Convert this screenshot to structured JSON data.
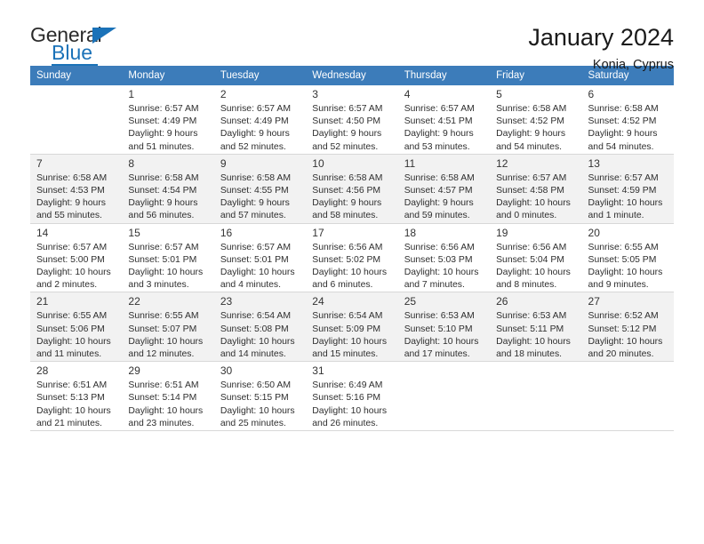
{
  "brand": {
    "name_part1": "General",
    "name_part2": "Blue",
    "accent_color": "#1b72b8"
  },
  "header": {
    "title": "January 2024",
    "subtitle": "Konia, Cyprus"
  },
  "calendar": {
    "header_bg": "#3c7cba",
    "weekday_headers": [
      "Sunday",
      "Monday",
      "Tuesday",
      "Wednesday",
      "Thursday",
      "Friday",
      "Saturday"
    ],
    "weeks": [
      {
        "shaded": false,
        "days": [
          {
            "day": "",
            "sunrise": "",
            "sunset": "",
            "daylight_line1": "",
            "daylight_line2": "",
            "empty": true
          },
          {
            "day": "1",
            "sunrise": "Sunrise: 6:57 AM",
            "sunset": "Sunset: 4:49 PM",
            "daylight_line1": "Daylight: 9 hours",
            "daylight_line2": "and 51 minutes.",
            "empty": false
          },
          {
            "day": "2",
            "sunrise": "Sunrise: 6:57 AM",
            "sunset": "Sunset: 4:49 PM",
            "daylight_line1": "Daylight: 9 hours",
            "daylight_line2": "and 52 minutes.",
            "empty": false
          },
          {
            "day": "3",
            "sunrise": "Sunrise: 6:57 AM",
            "sunset": "Sunset: 4:50 PM",
            "daylight_line1": "Daylight: 9 hours",
            "daylight_line2": "and 52 minutes.",
            "empty": false
          },
          {
            "day": "4",
            "sunrise": "Sunrise: 6:57 AM",
            "sunset": "Sunset: 4:51 PM",
            "daylight_line1": "Daylight: 9 hours",
            "daylight_line2": "and 53 minutes.",
            "empty": false
          },
          {
            "day": "5",
            "sunrise": "Sunrise: 6:58 AM",
            "sunset": "Sunset: 4:52 PM",
            "daylight_line1": "Daylight: 9 hours",
            "daylight_line2": "and 54 minutes.",
            "empty": false
          },
          {
            "day": "6",
            "sunrise": "Sunrise: 6:58 AM",
            "sunset": "Sunset: 4:52 PM",
            "daylight_line1": "Daylight: 9 hours",
            "daylight_line2": "and 54 minutes.",
            "empty": false
          }
        ]
      },
      {
        "shaded": true,
        "days": [
          {
            "day": "7",
            "sunrise": "Sunrise: 6:58 AM",
            "sunset": "Sunset: 4:53 PM",
            "daylight_line1": "Daylight: 9 hours",
            "daylight_line2": "and 55 minutes.",
            "empty": false
          },
          {
            "day": "8",
            "sunrise": "Sunrise: 6:58 AM",
            "sunset": "Sunset: 4:54 PM",
            "daylight_line1": "Daylight: 9 hours",
            "daylight_line2": "and 56 minutes.",
            "empty": false
          },
          {
            "day": "9",
            "sunrise": "Sunrise: 6:58 AM",
            "sunset": "Sunset: 4:55 PM",
            "daylight_line1": "Daylight: 9 hours",
            "daylight_line2": "and 57 minutes.",
            "empty": false
          },
          {
            "day": "10",
            "sunrise": "Sunrise: 6:58 AM",
            "sunset": "Sunset: 4:56 PM",
            "daylight_line1": "Daylight: 9 hours",
            "daylight_line2": "and 58 minutes.",
            "empty": false
          },
          {
            "day": "11",
            "sunrise": "Sunrise: 6:58 AM",
            "sunset": "Sunset: 4:57 PM",
            "daylight_line1": "Daylight: 9 hours",
            "daylight_line2": "and 59 minutes.",
            "empty": false
          },
          {
            "day": "12",
            "sunrise": "Sunrise: 6:57 AM",
            "sunset": "Sunset: 4:58 PM",
            "daylight_line1": "Daylight: 10 hours",
            "daylight_line2": "and 0 minutes.",
            "empty": false
          },
          {
            "day": "13",
            "sunrise": "Sunrise: 6:57 AM",
            "sunset": "Sunset: 4:59 PM",
            "daylight_line1": "Daylight: 10 hours",
            "daylight_line2": "and 1 minute.",
            "empty": false
          }
        ]
      },
      {
        "shaded": false,
        "days": [
          {
            "day": "14",
            "sunrise": "Sunrise: 6:57 AM",
            "sunset": "Sunset: 5:00 PM",
            "daylight_line1": "Daylight: 10 hours",
            "daylight_line2": "and 2 minutes.",
            "empty": false
          },
          {
            "day": "15",
            "sunrise": "Sunrise: 6:57 AM",
            "sunset": "Sunset: 5:01 PM",
            "daylight_line1": "Daylight: 10 hours",
            "daylight_line2": "and 3 minutes.",
            "empty": false
          },
          {
            "day": "16",
            "sunrise": "Sunrise: 6:57 AM",
            "sunset": "Sunset: 5:01 PM",
            "daylight_line1": "Daylight: 10 hours",
            "daylight_line2": "and 4 minutes.",
            "empty": false
          },
          {
            "day": "17",
            "sunrise": "Sunrise: 6:56 AM",
            "sunset": "Sunset: 5:02 PM",
            "daylight_line1": "Daylight: 10 hours",
            "daylight_line2": "and 6 minutes.",
            "empty": false
          },
          {
            "day": "18",
            "sunrise": "Sunrise: 6:56 AM",
            "sunset": "Sunset: 5:03 PM",
            "daylight_line1": "Daylight: 10 hours",
            "daylight_line2": "and 7 minutes.",
            "empty": false
          },
          {
            "day": "19",
            "sunrise": "Sunrise: 6:56 AM",
            "sunset": "Sunset: 5:04 PM",
            "daylight_line1": "Daylight: 10 hours",
            "daylight_line2": "and 8 minutes.",
            "empty": false
          },
          {
            "day": "20",
            "sunrise": "Sunrise: 6:55 AM",
            "sunset": "Sunset: 5:05 PM",
            "daylight_line1": "Daylight: 10 hours",
            "daylight_line2": "and 9 minutes.",
            "empty": false
          }
        ]
      },
      {
        "shaded": true,
        "days": [
          {
            "day": "21",
            "sunrise": "Sunrise: 6:55 AM",
            "sunset": "Sunset: 5:06 PM",
            "daylight_line1": "Daylight: 10 hours",
            "daylight_line2": "and 11 minutes.",
            "empty": false
          },
          {
            "day": "22",
            "sunrise": "Sunrise: 6:55 AM",
            "sunset": "Sunset: 5:07 PM",
            "daylight_line1": "Daylight: 10 hours",
            "daylight_line2": "and 12 minutes.",
            "empty": false
          },
          {
            "day": "23",
            "sunrise": "Sunrise: 6:54 AM",
            "sunset": "Sunset: 5:08 PM",
            "daylight_line1": "Daylight: 10 hours",
            "daylight_line2": "and 14 minutes.",
            "empty": false
          },
          {
            "day": "24",
            "sunrise": "Sunrise: 6:54 AM",
            "sunset": "Sunset: 5:09 PM",
            "daylight_line1": "Daylight: 10 hours",
            "daylight_line2": "and 15 minutes.",
            "empty": false
          },
          {
            "day": "25",
            "sunrise": "Sunrise: 6:53 AM",
            "sunset": "Sunset: 5:10 PM",
            "daylight_line1": "Daylight: 10 hours",
            "daylight_line2": "and 17 minutes.",
            "empty": false
          },
          {
            "day": "26",
            "sunrise": "Sunrise: 6:53 AM",
            "sunset": "Sunset: 5:11 PM",
            "daylight_line1": "Daylight: 10 hours",
            "daylight_line2": "and 18 minutes.",
            "empty": false
          },
          {
            "day": "27",
            "sunrise": "Sunrise: 6:52 AM",
            "sunset": "Sunset: 5:12 PM",
            "daylight_line1": "Daylight: 10 hours",
            "daylight_line2": "and 20 minutes.",
            "empty": false
          }
        ]
      },
      {
        "shaded": false,
        "days": [
          {
            "day": "28",
            "sunrise": "Sunrise: 6:51 AM",
            "sunset": "Sunset: 5:13 PM",
            "daylight_line1": "Daylight: 10 hours",
            "daylight_line2": "and 21 minutes.",
            "empty": false
          },
          {
            "day": "29",
            "sunrise": "Sunrise: 6:51 AM",
            "sunset": "Sunset: 5:14 PM",
            "daylight_line1": "Daylight: 10 hours",
            "daylight_line2": "and 23 minutes.",
            "empty": false
          },
          {
            "day": "30",
            "sunrise": "Sunrise: 6:50 AM",
            "sunset": "Sunset: 5:15 PM",
            "daylight_line1": "Daylight: 10 hours",
            "daylight_line2": "and 25 minutes.",
            "empty": false
          },
          {
            "day": "31",
            "sunrise": "Sunrise: 6:49 AM",
            "sunset": "Sunset: 5:16 PM",
            "daylight_line1": "Daylight: 10 hours",
            "daylight_line2": "and 26 minutes.",
            "empty": false
          },
          {
            "day": "",
            "sunrise": "",
            "sunset": "",
            "daylight_line1": "",
            "daylight_line2": "",
            "empty": true
          },
          {
            "day": "",
            "sunrise": "",
            "sunset": "",
            "daylight_line1": "",
            "daylight_line2": "",
            "empty": true
          },
          {
            "day": "",
            "sunrise": "",
            "sunset": "",
            "daylight_line1": "",
            "daylight_line2": "",
            "empty": true
          }
        ]
      }
    ]
  }
}
